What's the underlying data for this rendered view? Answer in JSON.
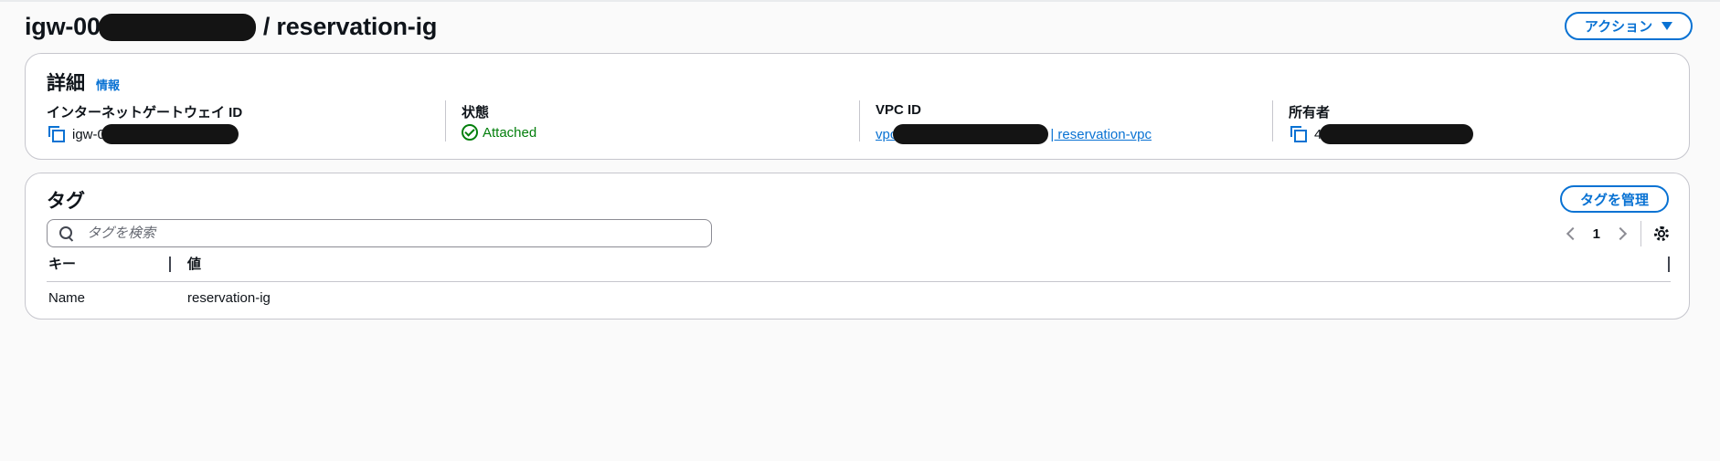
{
  "header": {
    "title_prefix": "igw-00",
    "title_suffix": "/ reservation-ig",
    "actions_label": "アクション"
  },
  "details": {
    "title": "詳細",
    "info_label": "情報",
    "fields": [
      {
        "label": "インターネットゲートウェイ ID",
        "value": "igw-0"
      },
      {
        "label": "状態",
        "value": "Attached"
      },
      {
        "label": "VPC ID",
        "value_prefix": "vpc",
        "value_suffix": "| reservation-vpc"
      },
      {
        "label": "所有者",
        "value": "4"
      }
    ]
  },
  "tags": {
    "title": "タグ",
    "manage_label": "タグを管理",
    "search_placeholder": "タグを検索",
    "page": "1",
    "columns": [
      "キー",
      "値"
    ],
    "rows": [
      {
        "key": "Name",
        "value": "reservation-ig"
      }
    ]
  },
  "colors": {
    "accent": "#0972d3",
    "success": "#037f0c",
    "border": "#c6c6cd"
  }
}
